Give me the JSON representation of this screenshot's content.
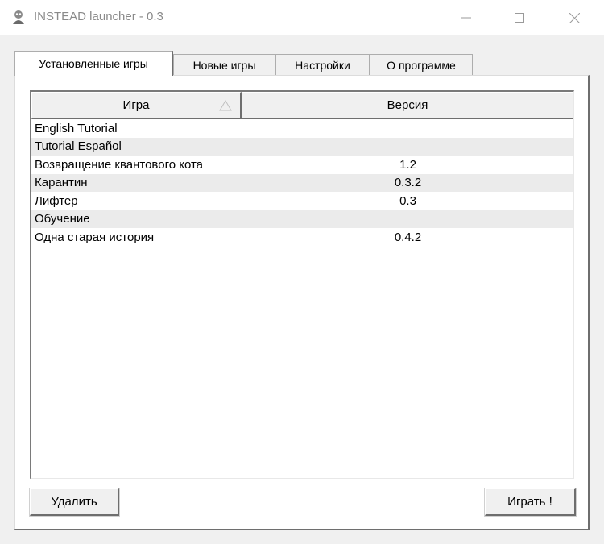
{
  "window": {
    "title": "INSTEAD launcher - 0.3",
    "icon": "app-icon",
    "controls": {
      "minimize": "—",
      "maximize": "☐",
      "close": "✕"
    }
  },
  "tabs": [
    {
      "label": "Установленные игры",
      "active": true
    },
    {
      "label": "Новые игры",
      "active": false
    },
    {
      "label": "Настройки",
      "active": false
    },
    {
      "label": "О программе",
      "active": false
    }
  ],
  "games_list": {
    "columns": {
      "name": "Игра",
      "version": "Версия"
    },
    "sort_indicator": "sort-ascending-icon",
    "rows": [
      {
        "name": "English Tutorial",
        "version": ""
      },
      {
        "name": "Tutorial Español",
        "version": ""
      },
      {
        "name": "Возвращение квантового кота",
        "version": "1.2"
      },
      {
        "name": "Карантин",
        "version": "0.3.2"
      },
      {
        "name": "Лифтер",
        "version": "0.3"
      },
      {
        "name": "Обучение",
        "version": ""
      },
      {
        "name": "Одна старая история",
        "version": "0.4.2"
      }
    ]
  },
  "buttons": {
    "delete_label": "Удалить",
    "play_label": "Играть !"
  },
  "colors": {
    "row_alt": "#ebebeb",
    "panel": "#ffffff",
    "chrome": "#f0f0f0"
  }
}
